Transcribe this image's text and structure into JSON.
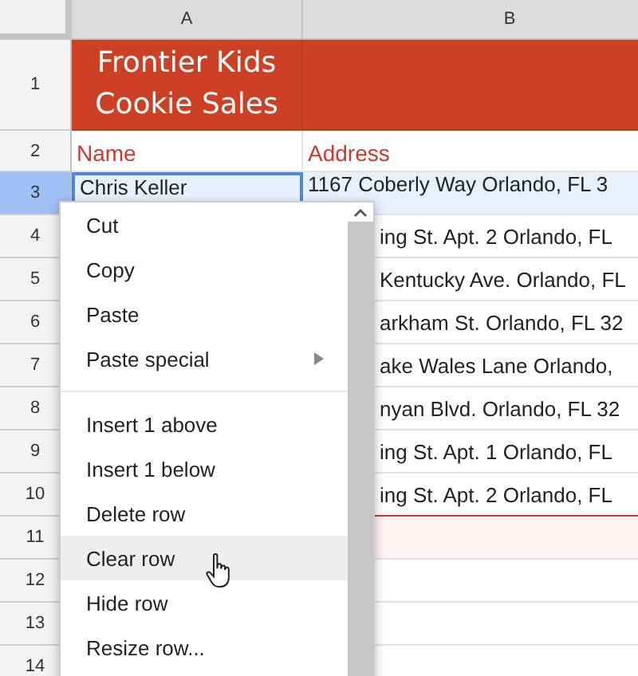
{
  "columns": [
    "A",
    "B"
  ],
  "title_row": {
    "number": "1",
    "title": "Frontier Kids Cookie Sales"
  },
  "header_row": {
    "number": "2",
    "cells": [
      "Name",
      "Address"
    ]
  },
  "rows": [
    {
      "number": "3",
      "selected": true,
      "shaded": false,
      "name": "Chris Keller",
      "address": "1167 Coberly Way Orlando, FL 3"
    },
    {
      "number": "4",
      "selected": false,
      "shaded": false,
      "address": "ing St. Apt. 2 Orlando, FL"
    },
    {
      "number": "5",
      "selected": false,
      "shaded": false,
      "address": "Kentucky Ave. Orlando, FL"
    },
    {
      "number": "6",
      "selected": false,
      "shaded": false,
      "address": "arkham St. Orlando, FL 32"
    },
    {
      "number": "7",
      "selected": false,
      "shaded": false,
      "address": "ake Wales Lane Orlando,"
    },
    {
      "number": "8",
      "selected": false,
      "shaded": false,
      "address": "nyan Blvd. Orlando, FL 32"
    },
    {
      "number": "9",
      "selected": false,
      "shaded": false,
      "address": "ing St. Apt. 1 Orlando, FL"
    },
    {
      "number": "10",
      "selected": false,
      "shaded": false,
      "address": "ing St. Apt. 2 Orlando, FL"
    },
    {
      "number": "11",
      "selected": false,
      "shaded": true
    },
    {
      "number": "12",
      "selected": false,
      "shaded": false
    },
    {
      "number": "13",
      "selected": false,
      "shaded": false
    },
    {
      "number": "14",
      "selected": false,
      "shaded": false
    }
  ],
  "context_menu": {
    "groups": [
      [
        {
          "label": "Cut",
          "selected": false,
          "submenu": false
        },
        {
          "label": "Copy",
          "selected": false,
          "submenu": false
        },
        {
          "label": "Paste",
          "selected": false,
          "submenu": false
        },
        {
          "label": "Paste special",
          "selected": false,
          "submenu": true
        }
      ],
      [
        {
          "label": "Insert 1 above",
          "selected": false,
          "submenu": false
        },
        {
          "label": "Insert 1 below",
          "selected": false,
          "submenu": false
        },
        {
          "label": "Delete row",
          "selected": false,
          "submenu": false
        },
        {
          "label": "Clear row",
          "selected": true,
          "submenu": false
        },
        {
          "label": "Hide row",
          "selected": false,
          "submenu": false
        },
        {
          "label": "Resize row...",
          "selected": false,
          "submenu": false
        }
      ]
    ]
  }
}
